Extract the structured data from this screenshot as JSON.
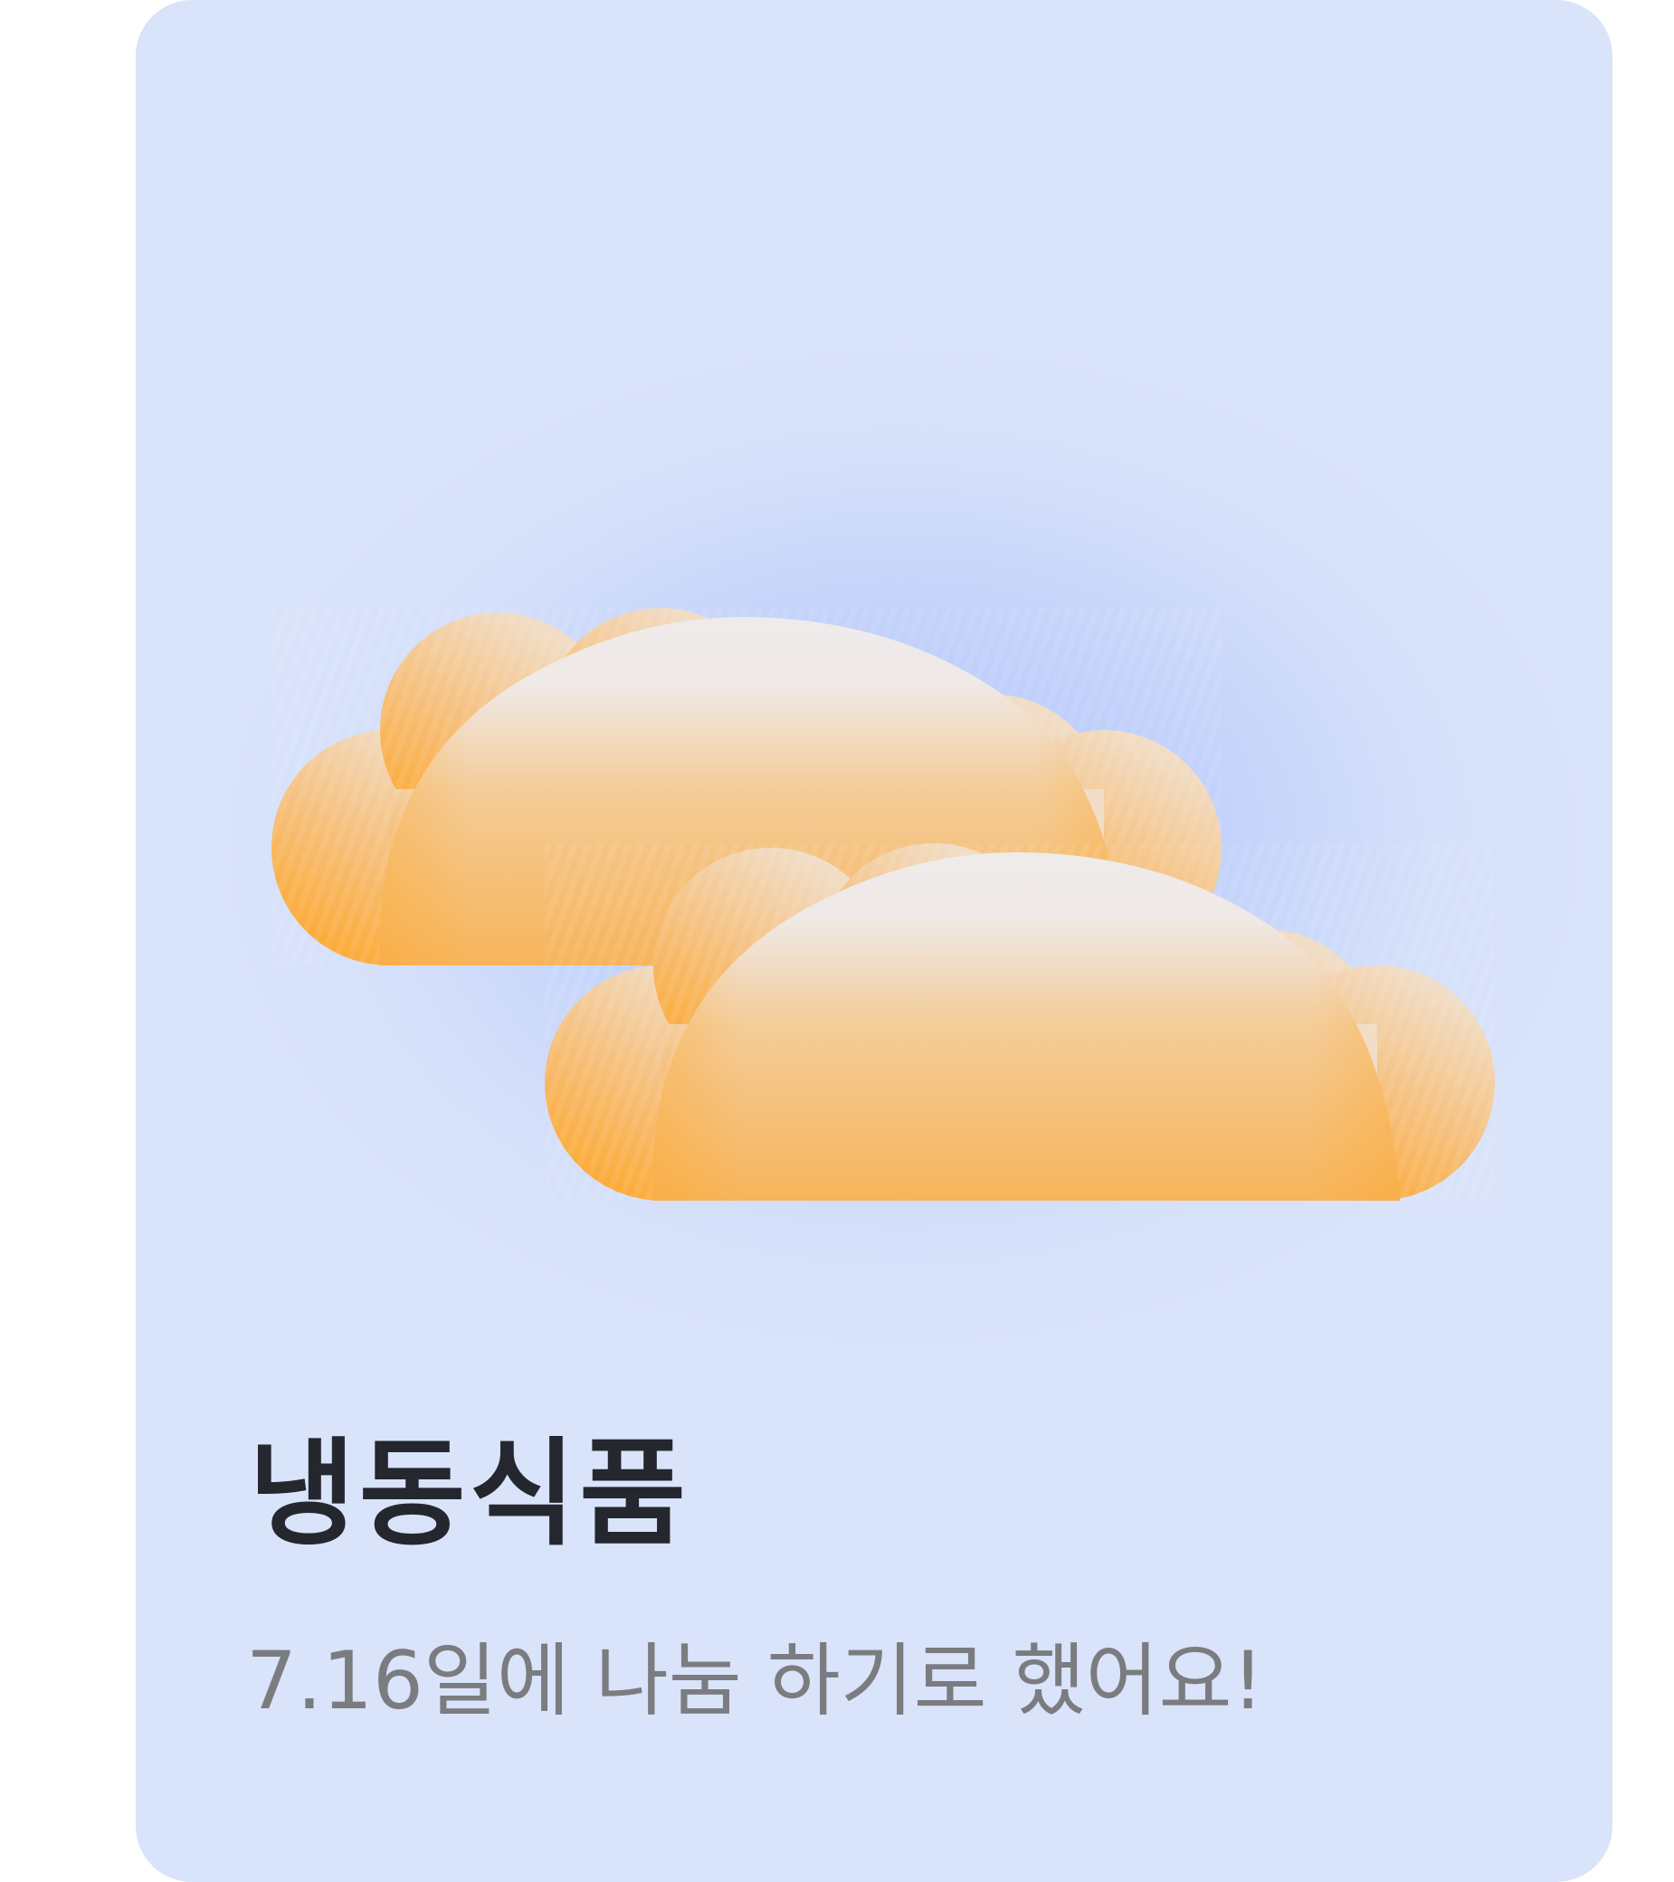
{
  "card": {
    "title": "냉동식품",
    "subtitle": "7.16일에 나눔 하기로 했어요!",
    "illustration": "dumpling-icon"
  },
  "colors": {
    "card_background": "#d9e3fa",
    "glow": "#b6c8fa",
    "dumpling_light": "#f0ece9",
    "dumpling_mid": "#f5c689",
    "dumpling_dark": "#ffa31f",
    "title_text": "#24272e",
    "subtitle_text": "#7b7c80"
  }
}
